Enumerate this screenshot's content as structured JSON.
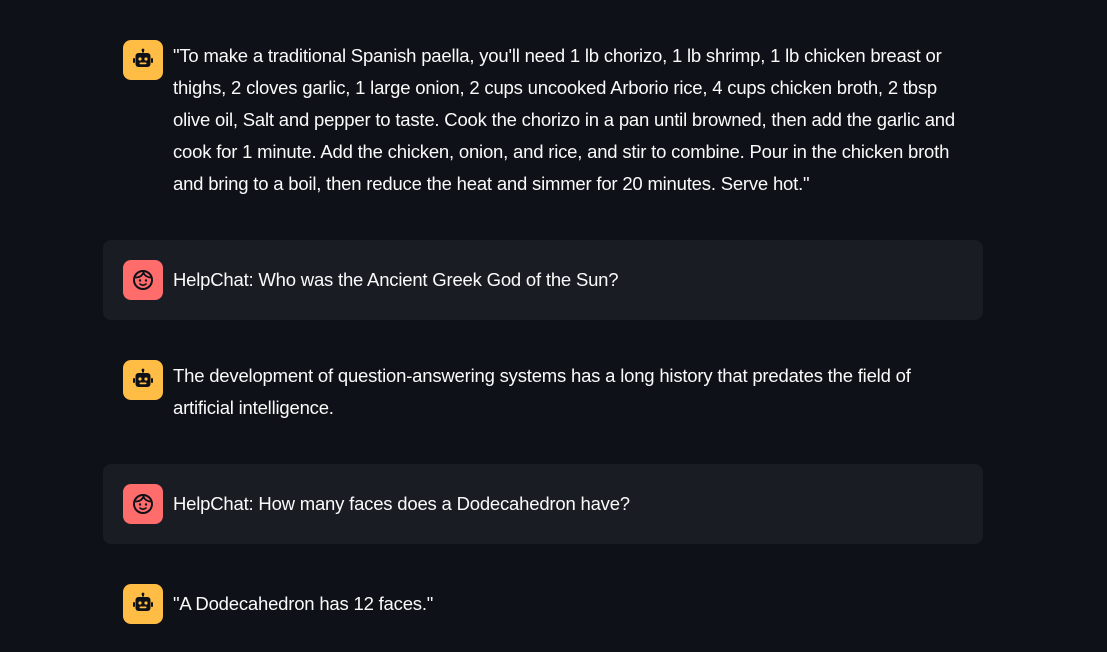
{
  "messages": [
    {
      "role": "assistant",
      "avatar_icon": "robot-icon",
      "text": "\"To make a traditional Spanish paella, you'll need 1 lb chorizo, 1 lb shrimp, 1 lb chicken breast or thighs, 2 cloves garlic, 1 large onion, 2 cups uncooked Arborio rice, 4 cups chicken broth, 2 tbsp olive oil, Salt and pepper to taste. Cook the chorizo in a pan until browned, then add the garlic and cook for 1 minute. Add the chicken, onion, and rice, and stir to combine. Pour in the chicken broth and bring to a boil, then reduce the heat and simmer for 20 minutes. Serve hot.\""
    },
    {
      "role": "user",
      "avatar_icon": "smiling-face-icon",
      "text": "HelpChat: Who was the Ancient Greek God of the Sun?"
    },
    {
      "role": "assistant",
      "avatar_icon": "robot-icon",
      "text": "The development of question-answering systems has a long history that predates the field of artificial intelligence."
    },
    {
      "role": "user",
      "avatar_icon": "smiling-face-icon",
      "text": "HelpChat: How many faces does a Dodecahedron have?"
    },
    {
      "role": "assistant",
      "avatar_icon": "robot-icon",
      "text": "\"A Dodecahedron has 12 faces.\""
    }
  ],
  "colors": {
    "background": "#0e1117",
    "user_bubble": "#1a1c24",
    "assistant_avatar": "#ffbd45",
    "user_avatar": "#ff6c6c",
    "text": "#fafafa"
  }
}
